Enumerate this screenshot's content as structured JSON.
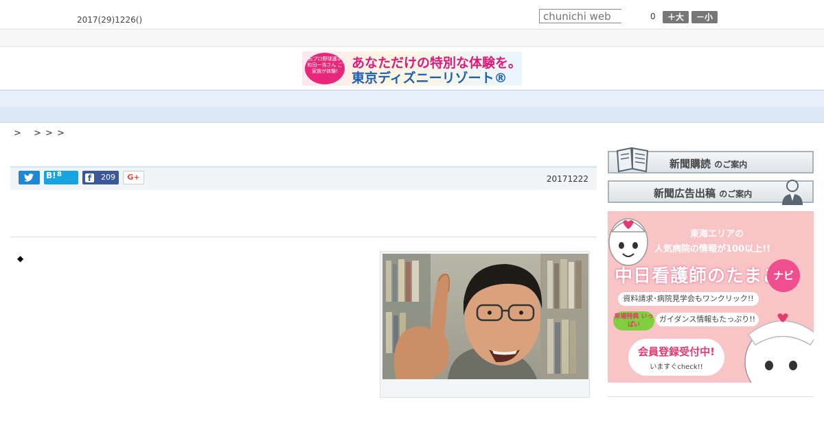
{
  "header": {
    "date": "2017(29)1226()",
    "search_placeholder": "chunichi web",
    "counter": "0",
    "font_large_label": "＋大",
    "font_small_label": "－小"
  },
  "banner": {
    "badge_text": "元プロ野球選手 和田一浩さん ご家族が体験!",
    "line1": "あなただけの特別な体験を。",
    "line2": "東京ディズニーリゾート®"
  },
  "nav": {
    "items": [
      "",
      "",
      "",
      "",
      "",
      "",
      "",
      "",
      ""
    ]
  },
  "breadcrumb": [
    ">",
    ">",
    ">",
    ">"
  ],
  "share": {
    "hatena_label": "B!",
    "hatena_count": "8",
    "facebook_count": "209",
    "gplus_label": "G+"
  },
  "article": {
    "date": "20171222",
    "bullet": "◆"
  },
  "sidebar": {
    "subscribe_main": "新聞購読",
    "subscribe_sub": "のご案内",
    "advertise_main": "新聞広告出稿",
    "advertise_sub": "のご案内"
  },
  "ad": {
    "line1": "東海エリアの",
    "line2": "人気病院の情報が100以上!!",
    "title": "中日看護師のたまご",
    "navi": "ナビ",
    "line3": "資料請求･病院見学会もワンクリック!!",
    "badge": "来場特典 いっぱい",
    "line4": "ガイダンス情報もたっぷり!!",
    "bubble1": "会員登録受付中!",
    "bubble2": "いますぐcheck!!"
  },
  "colors": {
    "twitter": "#1e87d8",
    "hatena": "#18a4e0",
    "facebook": "#3b5998",
    "gplus": "#dd4b39",
    "nav_bg": "#e7f0fb",
    "ad_bg": "#f9c4c6"
  }
}
